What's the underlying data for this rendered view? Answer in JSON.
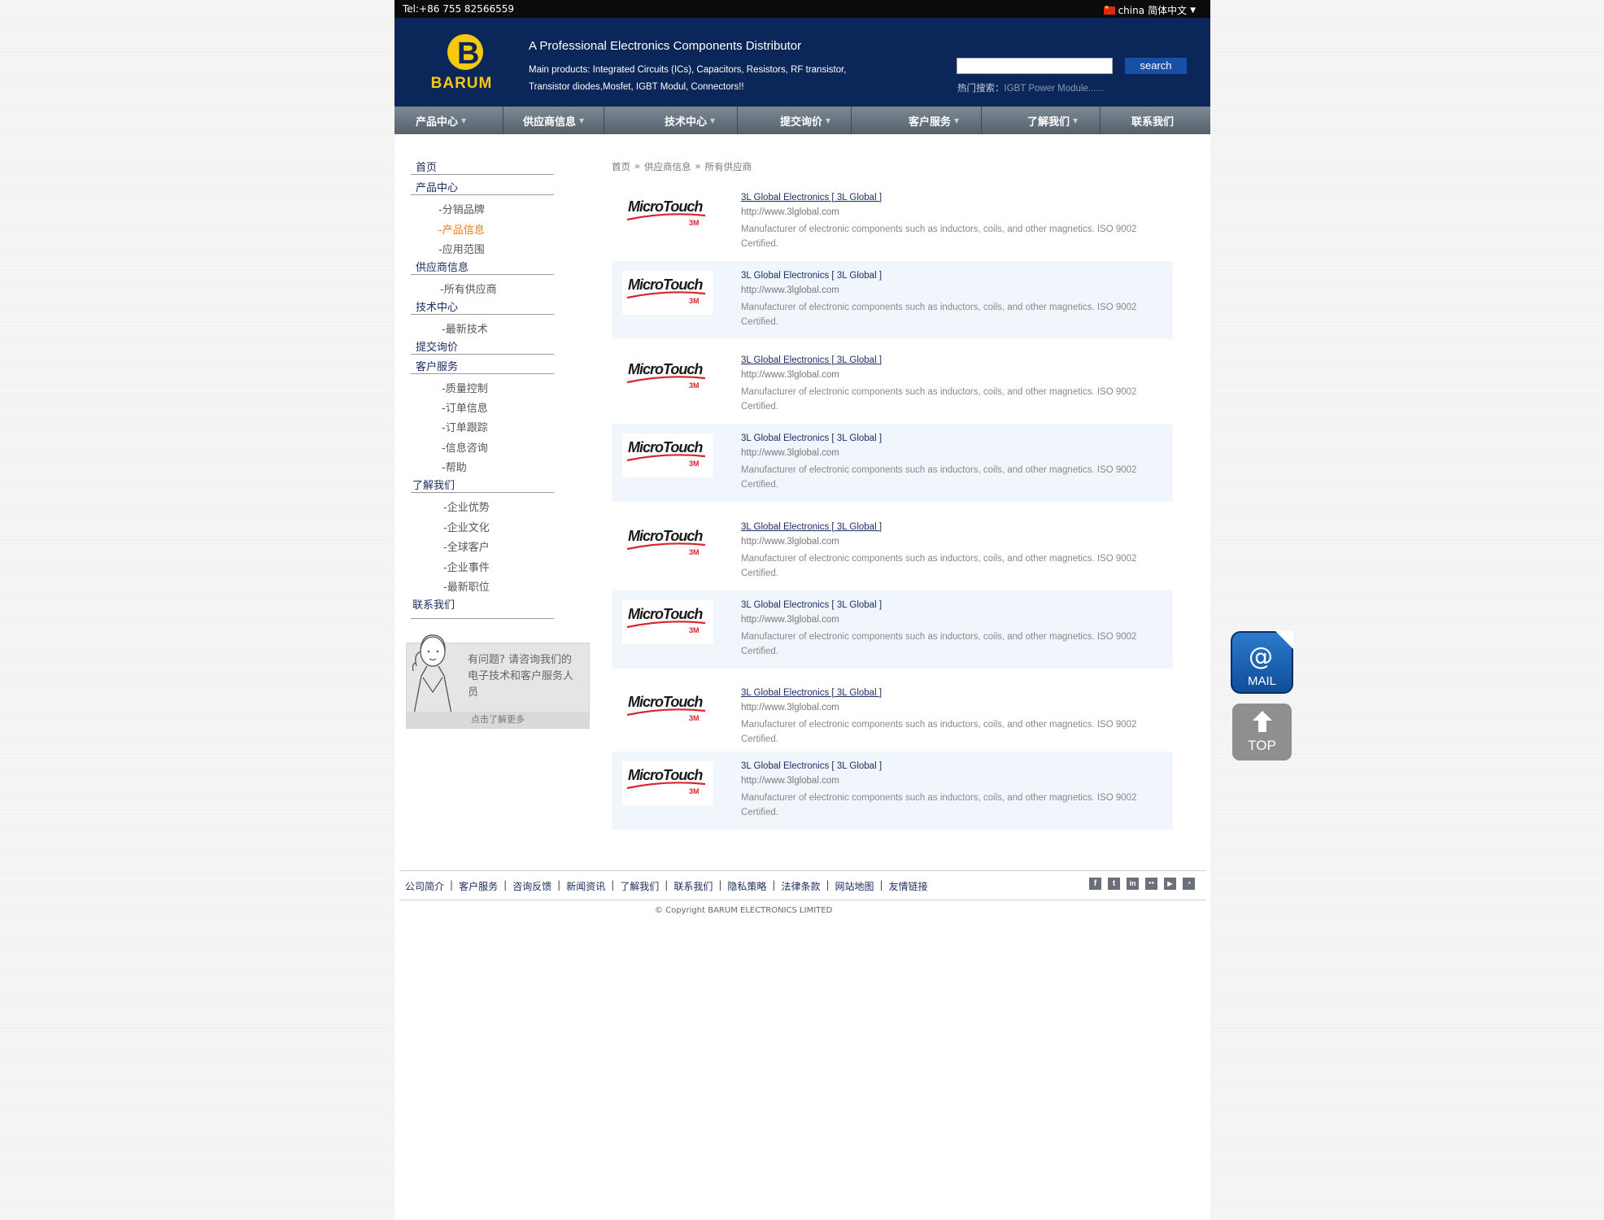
{
  "topbar": {
    "tel": "Tel:+86 755 82566559",
    "region": "china",
    "language": "简体中文"
  },
  "header": {
    "logo_text": "BARUM",
    "tagline": "A Professional Electronics Components Distributor",
    "products_line1": "Main products: Integrated Circuits (ICs), Capacitors, Resistors, RF transistor,",
    "products_line2": "Transistor diodes,Mosfet, IGBT Modul, Connectors!!",
    "search_button": "search",
    "hot_label": "热门搜索：",
    "hot_link": "IGBT Power Module......"
  },
  "nav": [
    {
      "label": "产品中心",
      "dropdown": true
    },
    {
      "label": "供应商信息",
      "dropdown": true
    },
    {
      "label": "技术中心",
      "dropdown": true
    },
    {
      "label": "提交询价",
      "dropdown": true
    },
    {
      "label": "客户服务",
      "dropdown": true
    },
    {
      "label": "了解我们",
      "dropdown": true
    },
    {
      "label": "联系我们",
      "dropdown": false
    }
  ],
  "sidebar": {
    "home": "首页",
    "products": "产品中心",
    "products_sub": [
      "-分销品牌",
      "-产品信息",
      "-应用范围"
    ],
    "suppliers": "供应商信息",
    "suppliers_sub": [
      "-所有供应商"
    ],
    "tech": "技术中心",
    "tech_sub": [
      "-最新技术"
    ],
    "inquiry": "提交询价",
    "service": "客户服务",
    "service_sub": [
      "-质量控制",
      "-订单信息",
      "-订单跟踪",
      "-信息咨询",
      "-帮助"
    ],
    "about": "了解我们",
    "about_sub": [
      "-企业优势",
      "-企业文化",
      "-全球客户",
      "-企业事件",
      "-最新职位"
    ],
    "contact": "联系我们",
    "help_text": "有问题? 请咨询我们的电子技术和客户服务人员",
    "help_more": "点击了解更多"
  },
  "breadcrumb": {
    "home": "首页",
    "sep": "»",
    "level1": "供应商信息",
    "level2": "所有供应商"
  },
  "suppliers": [
    {
      "logo_text": "MicroTouch",
      "logo_sub": "3M",
      "title": "3L Global Electronics [ 3L Global ]",
      "url": "http://www.3lglobal.com",
      "desc": "Manufacturer of electronic components such as inductors, coils, and other magnetics. ISO 9002 Certified."
    },
    {
      "logo_text": "MicroTouch",
      "logo_sub": "3M",
      "title": "3L Global Electronics [ 3L Global ]",
      "url": "http://www.3lglobal.com",
      "desc": "Manufacturer of electronic components such as inductors, coils, and other magnetics. ISO 9002 Certified."
    },
    {
      "logo_text": "MicroTouch",
      "logo_sub": "3M",
      "title": "3L Global Electronics [ 3L Global ]",
      "url": "http://www.3lglobal.com",
      "desc": "Manufacturer of electronic components such as inductors, coils, and other magnetics. ISO 9002 Certified."
    },
    {
      "logo_text": "MicroTouch",
      "logo_sub": "3M",
      "title": "3L Global Electronics [ 3L Global ]",
      "url": "http://www.3lglobal.com",
      "desc": "Manufacturer of electronic components such as inductors, coils, and other magnetics. ISO 9002 Certified."
    },
    {
      "logo_text": "MicroTouch",
      "logo_sub": "3M",
      "title": "3L Global Electronics [ 3L Global ]",
      "url": "http://www.3lglobal.com",
      "desc": "Manufacturer of electronic components such as inductors, coils, and other magnetics. ISO 9002 Certified."
    },
    {
      "logo_text": "MicroTouch",
      "logo_sub": "3M",
      "title": "3L Global Electronics [ 3L Global ]",
      "url": "http://www.3lglobal.com",
      "desc": "Manufacturer of electronic components such as inductors, coils, and other magnetics. ISO 9002 Certified."
    },
    {
      "logo_text": "MicroTouch",
      "logo_sub": "3M",
      "title": "3L Global Electronics [ 3L Global ]",
      "url": "http://www.3lglobal.com",
      "desc": "Manufacturer of electronic components such as inductors, coils, and other magnetics. ISO 9002 Certified."
    },
    {
      "logo_text": "MicroTouch",
      "logo_sub": "3M",
      "title": "3L Global Electronics [ 3L Global ]",
      "url": "http://www.3lglobal.com",
      "desc": "Manufacturer of electronic components such as inductors, coils, and other magnetics. ISO 9002 Certified."
    }
  ],
  "footer": {
    "links": [
      "公司简介",
      "客户服务",
      "咨询反馈",
      "新闻资讯",
      "了解我们",
      "联系我们",
      "隐私策略",
      "法律条款",
      "网站地图",
      "友情链接"
    ],
    "separator": "|",
    "social": [
      {
        "icon": "facebook-icon",
        "glyph": "f"
      },
      {
        "icon": "twitter-icon",
        "glyph": "t"
      },
      {
        "icon": "linkedin-icon",
        "glyph": "in"
      },
      {
        "icon": "flickr-icon",
        "glyph": "●●"
      },
      {
        "icon": "youtube-icon",
        "glyph": "▶"
      },
      {
        "icon": "rss-icon",
        "glyph": "◔"
      }
    ],
    "copyright": "© Copyright BARUM ELECTRONICS LIMITED"
  },
  "float": {
    "mail_label": "MAIL",
    "mail_glyph": "@",
    "top_label": "TOP"
  },
  "colors": {
    "header_bg": "#0b2658",
    "logo_yellow": "#f6c90e",
    "active_link": "#e57c12",
    "link_blue": "#1c2e63",
    "row_alt_bg": "#f1f6fc"
  }
}
